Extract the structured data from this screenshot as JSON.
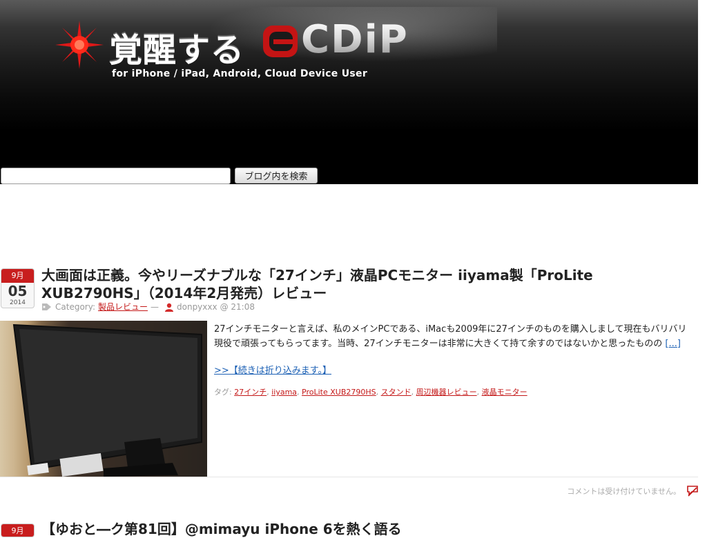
{
  "header": {
    "logo_text_jp": "覚醒する",
    "logo_text_brand": "CDiP",
    "tagline": "for iPhone / iPad, Android, Cloud Device User",
    "accent_color": "#d41c1c"
  },
  "search": {
    "value": "",
    "button_label": "ブログ内を検索"
  },
  "posts": [
    {
      "date": {
        "month": "9月",
        "day": "05",
        "year": "2014"
      },
      "title": "大画面は正義。今やリーズナブルな「27インチ」液晶PCモニター iiyama製「ProLite XUB2790HS」（2014年2月発売）レビュー",
      "meta": {
        "category_label": "Category:",
        "category": "製品レビュー",
        "separator": "—",
        "author": "donpyxxx",
        "time": "@ 21:08"
      },
      "excerpt": "27インチモニターと言えば、私のメインPCである、iMacも2009年に27インチのものを購入しまして現在もバリバリ現役で頑張ってもらってます。当時、27インチモニターは非常に大きくて持て余すのではないかと思ったものの",
      "excerpt_more": "[...]",
      "more_link": ">>【続きは折り込みます。】",
      "tags_label": "タグ:",
      "tags": [
        "27インチ",
        "iiyama",
        "ProLite XUB2790HS",
        "スタンド",
        "周辺機器レビュー",
        "液晶モニター"
      ],
      "comments_note": "コメントは受け付けていません。"
    },
    {
      "date": {
        "month": "9月"
      },
      "title": "【ゆおと―ク第81回】@mimayu iPhone 6を熱く語る"
    }
  ],
  "icons": {
    "sun": "sun-logo-icon",
    "tag": "tag-icon",
    "author": "author-icon",
    "comment": "comment-icon"
  }
}
